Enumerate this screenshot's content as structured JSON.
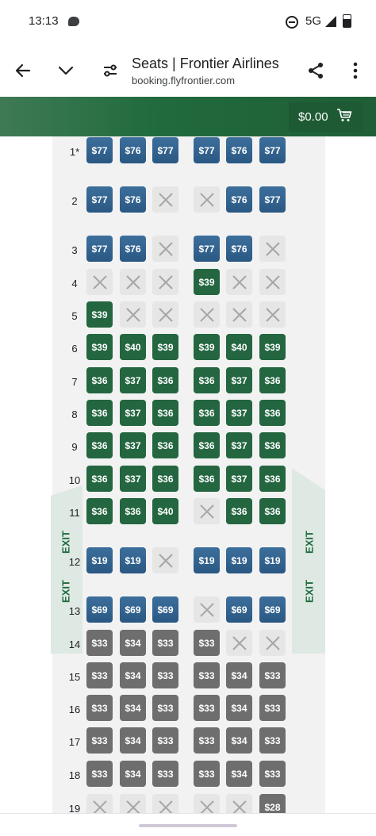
{
  "status_bar": {
    "time": "13:13",
    "network": "5G"
  },
  "browser": {
    "title": "Seats | Frontier Airlines",
    "url": "booking.flyfrontier.com"
  },
  "cart": {
    "total": "$0.00"
  },
  "exit_label": "EXIT",
  "colors": {
    "blue": "#2a5883",
    "green": "#236640",
    "gray": "#6e6e6e",
    "unavailable": "#e6e6e6",
    "brand_green": "#1e5a34"
  },
  "rows": [
    {
      "label": "1*",
      "seats": [
        [
          "$77",
          "blue"
        ],
        [
          "$76",
          "blue"
        ],
        [
          "$77",
          "blue"
        ],
        [
          "$77",
          "blue"
        ],
        [
          "$76",
          "blue"
        ],
        [
          "$77",
          "blue"
        ]
      ]
    },
    {
      "label": "2",
      "seats": [
        [
          "$77",
          "blue"
        ],
        [
          "$76",
          "blue"
        ],
        [
          "",
          "x"
        ],
        [
          "",
          "x"
        ],
        [
          "$76",
          "blue"
        ],
        [
          "$77",
          "blue"
        ]
      ]
    },
    {
      "label": "3",
      "seats": [
        [
          "$77",
          "blue"
        ],
        [
          "$76",
          "blue"
        ],
        [
          "",
          "x"
        ],
        [
          "$77",
          "blue"
        ],
        [
          "$76",
          "blue"
        ],
        [
          "",
          "x"
        ]
      ]
    },
    {
      "label": "4",
      "seats": [
        [
          "",
          "x"
        ],
        [
          "",
          "x"
        ],
        [
          "",
          "x"
        ],
        [
          "$39",
          "green"
        ],
        [
          "",
          "x"
        ],
        [
          "",
          "x"
        ]
      ]
    },
    {
      "label": "5",
      "seats": [
        [
          "$39",
          "green"
        ],
        [
          "",
          "x"
        ],
        [
          "",
          "x"
        ],
        [
          "",
          "x"
        ],
        [
          "",
          "x"
        ],
        [
          "",
          "x"
        ]
      ]
    },
    {
      "label": "6",
      "seats": [
        [
          "$39",
          "green"
        ],
        [
          "$40",
          "green"
        ],
        [
          "$39",
          "green"
        ],
        [
          "$39",
          "green"
        ],
        [
          "$40",
          "green"
        ],
        [
          "$39",
          "green"
        ]
      ]
    },
    {
      "label": "7",
      "seats": [
        [
          "$36",
          "green"
        ],
        [
          "$37",
          "green"
        ],
        [
          "$36",
          "green"
        ],
        [
          "$36",
          "green"
        ],
        [
          "$37",
          "green"
        ],
        [
          "$36",
          "green"
        ]
      ]
    },
    {
      "label": "8",
      "seats": [
        [
          "$36",
          "green"
        ],
        [
          "$37",
          "green"
        ],
        [
          "$36",
          "green"
        ],
        [
          "$36",
          "green"
        ],
        [
          "$37",
          "green"
        ],
        [
          "$36",
          "green"
        ]
      ]
    },
    {
      "label": "9",
      "seats": [
        [
          "$36",
          "green"
        ],
        [
          "$37",
          "green"
        ],
        [
          "$36",
          "green"
        ],
        [
          "$36",
          "green"
        ],
        [
          "$37",
          "green"
        ],
        [
          "$36",
          "green"
        ]
      ]
    },
    {
      "label": "10",
      "seats": [
        [
          "$36",
          "green"
        ],
        [
          "$37",
          "green"
        ],
        [
          "$36",
          "green"
        ],
        [
          "$36",
          "green"
        ],
        [
          "$37",
          "green"
        ],
        [
          "$36",
          "green"
        ]
      ]
    },
    {
      "label": "11",
      "seats": [
        [
          "$36",
          "green"
        ],
        [
          "$36",
          "green"
        ],
        [
          "$40",
          "green"
        ],
        [
          "",
          "x"
        ],
        [
          "$36",
          "green"
        ],
        [
          "$36",
          "green"
        ]
      ]
    },
    {
      "label": "12",
      "seats": [
        [
          "$19",
          "blue"
        ],
        [
          "$19",
          "blue"
        ],
        [
          "",
          "x"
        ],
        [
          "$19",
          "blue"
        ],
        [
          "$19",
          "blue"
        ],
        [
          "$19",
          "blue"
        ]
      ]
    },
    {
      "label": "13",
      "seats": [
        [
          "$69",
          "blue"
        ],
        [
          "$69",
          "blue"
        ],
        [
          "$69",
          "blue"
        ],
        [
          "",
          "x"
        ],
        [
          "$69",
          "blue"
        ],
        [
          "$69",
          "blue"
        ]
      ]
    },
    {
      "label": "14",
      "seats": [
        [
          "$33",
          "gray"
        ],
        [
          "$34",
          "gray"
        ],
        [
          "$33",
          "gray"
        ],
        [
          "$33",
          "gray"
        ],
        [
          "",
          "x"
        ],
        [
          "",
          "x"
        ]
      ]
    },
    {
      "label": "15",
      "seats": [
        [
          "$33",
          "gray"
        ],
        [
          "$34",
          "gray"
        ],
        [
          "$33",
          "gray"
        ],
        [
          "$33",
          "gray"
        ],
        [
          "$34",
          "gray"
        ],
        [
          "$33",
          "gray"
        ]
      ]
    },
    {
      "label": "16",
      "seats": [
        [
          "$33",
          "gray"
        ],
        [
          "$34",
          "gray"
        ],
        [
          "$33",
          "gray"
        ],
        [
          "$33",
          "gray"
        ],
        [
          "$34",
          "gray"
        ],
        [
          "$33",
          "gray"
        ]
      ]
    },
    {
      "label": "17",
      "seats": [
        [
          "$33",
          "gray"
        ],
        [
          "$34",
          "gray"
        ],
        [
          "$33",
          "gray"
        ],
        [
          "$33",
          "gray"
        ],
        [
          "$34",
          "gray"
        ],
        [
          "$33",
          "gray"
        ]
      ]
    },
    {
      "label": "18",
      "seats": [
        [
          "$33",
          "gray"
        ],
        [
          "$34",
          "gray"
        ],
        [
          "$33",
          "gray"
        ],
        [
          "$33",
          "gray"
        ],
        [
          "$34",
          "gray"
        ],
        [
          "$33",
          "gray"
        ]
      ]
    },
    {
      "label": "19",
      "seats": [
        [
          "",
          "x"
        ],
        [
          "",
          "x"
        ],
        [
          "",
          "x"
        ],
        [
          "",
          "x"
        ],
        [
          "",
          "x"
        ],
        [
          "$28",
          "gray"
        ]
      ]
    }
  ]
}
